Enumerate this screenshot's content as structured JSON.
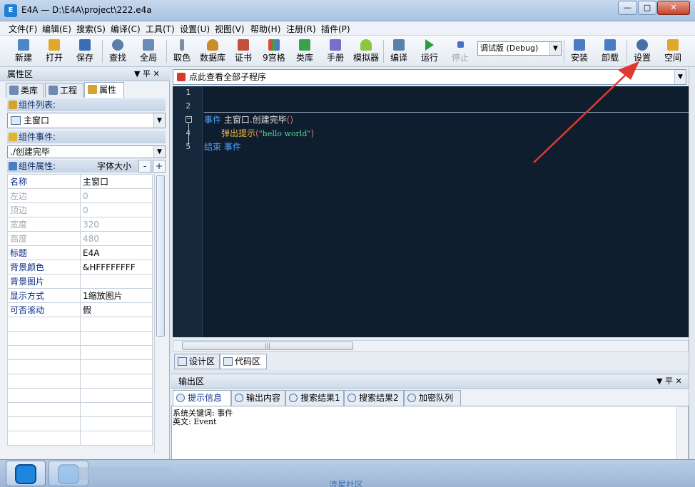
{
  "window": {
    "title": "E4A — D:\\E4A\\project\\222.e4a",
    "icon": "e4a-app-icon",
    "minimize": "—",
    "maximize": "□",
    "close": "✕"
  },
  "menu": [
    "文件(F)",
    "编辑(E)",
    "搜索(S)",
    "编译(C)",
    "工具(T)",
    "设置(U)",
    "视图(V)",
    "帮助(H)",
    "注册(R)",
    "插件(P)"
  ],
  "toolbar": {
    "buttons": [
      {
        "label": "新建",
        "icon": "new-file-icon",
        "color": "#4f86c6"
      },
      {
        "label": "打开",
        "icon": "open-folder-icon",
        "color": "#e0a82a"
      },
      {
        "label": "保存",
        "icon": "save-icon",
        "color": "#3b6db3"
      },
      {
        "label": "查找",
        "icon": "search-icon",
        "color": "#5a7fa8"
      },
      {
        "label": "全局",
        "icon": "global-icon",
        "color": "#6a8bb5"
      },
      {
        "label": "取色",
        "icon": "color-picker-icon",
        "color": "#7b8fa6"
      },
      {
        "label": "数据库",
        "icon": "database-icon",
        "color": "#c98d2a"
      },
      {
        "label": "证书",
        "icon": "certificate-icon",
        "color": "#c44f3a"
      },
      {
        "label": "9宫格",
        "icon": "grid-icon",
        "color": "#d64b3a"
      },
      {
        "label": "类库",
        "icon": "library-icon",
        "color": "#3aa14c"
      },
      {
        "label": "手册",
        "icon": "manual-icon",
        "color": "#7a6ec9"
      },
      {
        "label": "模拟器",
        "icon": "android-icon",
        "color": "#8cc63f"
      },
      {
        "label": "编译",
        "icon": "compile-icon",
        "color": "#5a7fa8"
      },
      {
        "label": "运行",
        "icon": "run-icon",
        "color": "#2e9a3c"
      },
      {
        "label": "停止",
        "icon": "stop-icon",
        "color": "#4a6fc6"
      },
      {
        "label": "安装",
        "icon": "install-icon",
        "color": "#4a7cc6"
      },
      {
        "label": "卸载",
        "icon": "uninstall-icon",
        "color": "#4a7cc6"
      },
      {
        "label": "设置",
        "icon": "settings-info-icon",
        "color": "#4a6fa8"
      },
      {
        "label": "空间",
        "icon": "workspace-folder-icon",
        "color": "#e0a82a"
      }
    ],
    "build_mode": "调试版 (Debug)"
  },
  "left_panel": {
    "title": "属性区",
    "pin": "▼ 平 ✕",
    "tabs": [
      "类库",
      "工程",
      "属性"
    ],
    "component_list_label": "组件列表:",
    "component_selected": "主窗口",
    "component_event_label": "组件事件:",
    "event_selected": "./创建完毕",
    "component_props_label": "组件属性:",
    "font_size_label": "字体大小",
    "minus": "-",
    "plus": "+",
    "properties": [
      {
        "key": "名称",
        "value": "主窗口",
        "disabled": false
      },
      {
        "key": "左边",
        "value": "0",
        "disabled": true
      },
      {
        "key": "顶边",
        "value": "0",
        "disabled": true
      },
      {
        "key": "宽度",
        "value": "320",
        "disabled": true
      },
      {
        "key": "高度",
        "value": "480",
        "disabled": true
      },
      {
        "key": "标题",
        "value": "E4A",
        "disabled": false
      },
      {
        "key": "背景颜色",
        "value": "&HFFFFFFFF",
        "disabled": false
      },
      {
        "key": "背景图片",
        "value": "",
        "disabled": false
      },
      {
        "key": "显示方式",
        "value": "1缩放图片",
        "disabled": false
      },
      {
        "key": "可否滚动",
        "value": "假",
        "disabled": false
      }
    ]
  },
  "editor": {
    "subroutine_combo": "点此查看全部子程序",
    "lines": [
      "1",
      "2",
      "3",
      "4",
      "5"
    ],
    "code": {
      "line3_kw": "事件",
      "line3_name": "主窗口.创建完毕",
      "line3_paren": "()",
      "line4_call": "弹出提示",
      "line4_open": "(",
      "line4_str": "\"hello world\"",
      "line4_close": ")",
      "line5_kw": "结束 事件"
    },
    "hscroll_grip": "|||",
    "tabs": [
      "设计区",
      "代码区"
    ]
  },
  "output": {
    "title": "输出区",
    "controls": "▼ 平 ✕",
    "tabs": [
      "提示信息",
      "输出内容",
      "搜索结果1",
      "搜索结果2",
      "加密队列"
    ],
    "lines": [
      "系统关键词: 事件",
      "英文: Event"
    ]
  },
  "taskbar": {
    "footer": "流星社区"
  },
  "colors": {
    "annotation_arrow": "#e03a2e",
    "code_bg": "#0f1e2f"
  }
}
